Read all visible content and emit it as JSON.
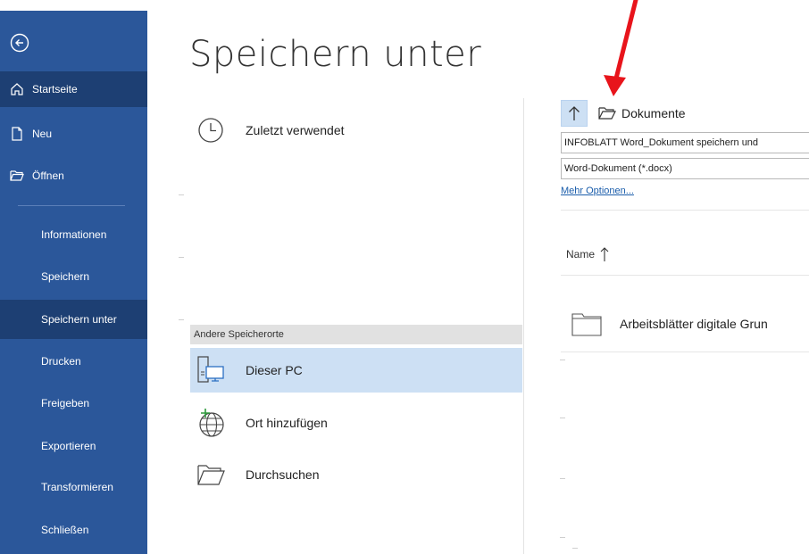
{
  "nav": {
    "items": [
      {
        "label": "Startseite",
        "icon": "home-icon"
      },
      {
        "label": "Neu",
        "icon": "new-document-icon"
      },
      {
        "label": "Öffnen",
        "icon": "open-folder-icon"
      }
    ],
    "sub_items": [
      {
        "label": "Informationen"
      },
      {
        "label": "Speichern"
      },
      {
        "label": "Speichern unter"
      },
      {
        "label": "Drucken"
      },
      {
        "label": "Freigeben"
      },
      {
        "label": "Exportieren"
      },
      {
        "label": "Transformieren"
      },
      {
        "label": "Schließen"
      }
    ]
  },
  "title": "Speichern unter",
  "locations": {
    "recent": "Zuletzt verwendet",
    "other_header": "Andere Speicherorte",
    "this_pc": "Dieser PC",
    "add_place": "Ort hinzufügen",
    "browse": "Durchsuchen"
  },
  "right": {
    "path": "Dokumente",
    "filename": "INFOBLATT Word_Dokument speichern und",
    "filetype": "Word-Dokument (*.docx)",
    "more_options": "Mehr Optionen...",
    "column_name": "Name",
    "folder": "Arbeitsblätter digitale Grun"
  },
  "colors": {
    "nav_bg": "#2b579a",
    "nav_active": "#1d3f73",
    "selected_bg": "#cde0f4",
    "annotation_arrow": "#e8141b"
  }
}
